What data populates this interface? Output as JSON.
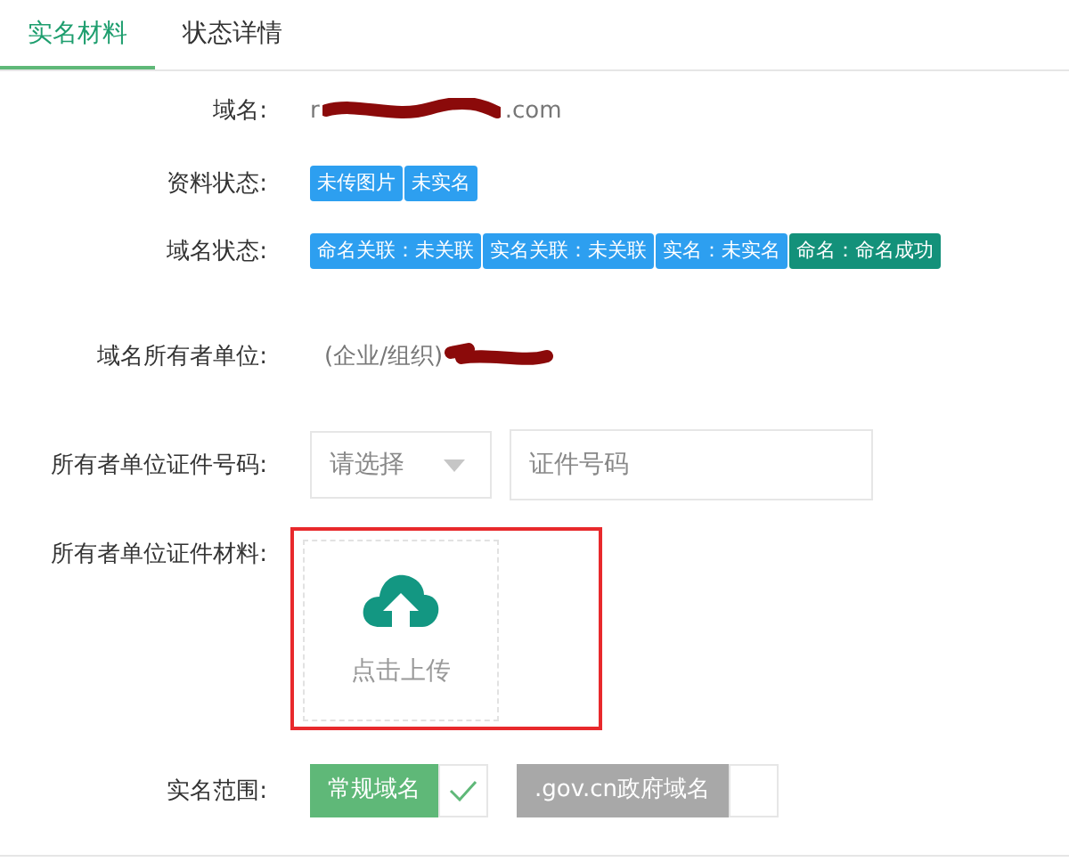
{
  "tabs": [
    {
      "label": "实名材料",
      "selected": true
    },
    {
      "label": "状态详情",
      "selected": false
    }
  ],
  "domain": {
    "label": "域名:",
    "value_start": "r",
    "value_end": ".com"
  },
  "material_status": {
    "label": "资料状态:",
    "tags": [
      {
        "text": "未传图片",
        "color": "#2d9ff0"
      },
      {
        "text": "未实名",
        "color": "#2d9ff0"
      }
    ]
  },
  "domain_status": {
    "label": "域名状态:",
    "tags": [
      {
        "text": "命名关联：未关联",
        "color": "#2d9ff0"
      },
      {
        "text": "实名关联：未关联",
        "color": "#2d9ff0"
      },
      {
        "text": "实名：未实名",
        "color": "#2d9ff0"
      },
      {
        "text": "命名：命名成功",
        "color": "#13917a"
      }
    ]
  },
  "owner": {
    "label": "域名所有者单位:",
    "value": "(企业/组织)"
  },
  "certificate_number": {
    "label": "所有者单位证件号码:",
    "select_placeholder": "请选择",
    "placeholder": "证件号码"
  },
  "certificate_material": {
    "label": "所有者单位证件材料:",
    "upload_text": "点击上传"
  },
  "scope": {
    "label": "实名范围:",
    "options": [
      {
        "text": "常规域名",
        "selected": true
      },
      {
        "text": ".gov.cn政府域名",
        "selected": false
      }
    ]
  }
}
